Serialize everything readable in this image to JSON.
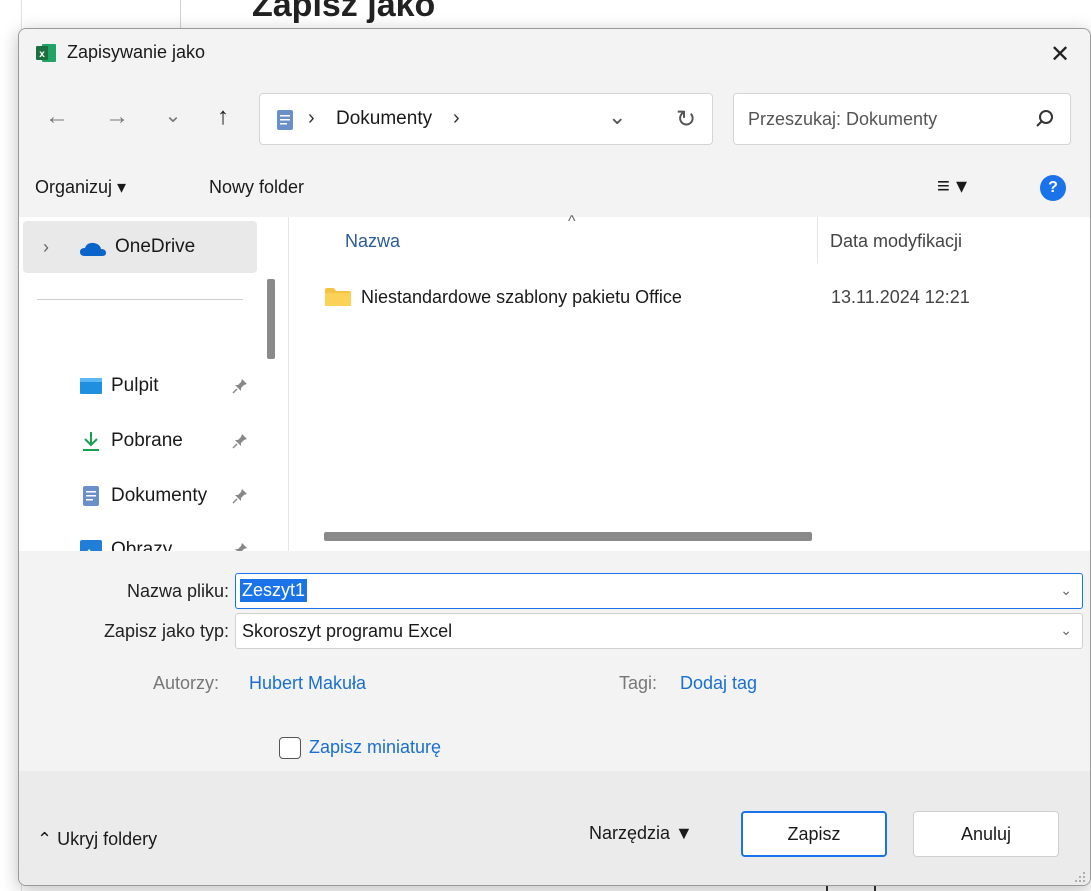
{
  "background": {
    "title": "Zapisz jako"
  },
  "dialog": {
    "title": "Zapisywanie jako",
    "close_glyph": "✕",
    "app_icon_letter": "x"
  },
  "nav": {
    "back_glyph": "←",
    "forward_glyph": "→",
    "recent_glyph": "⌄",
    "up_glyph": "↑"
  },
  "address": {
    "path_separator": "›",
    "location": "Dokumenty",
    "dropdown_glyph": "⌄",
    "refresh_glyph": "↻"
  },
  "search": {
    "placeholder": "Przeszukaj: Dokumenty"
  },
  "toolbar": {
    "organize": "Organizuj ▾",
    "new_folder": "Nowy folder",
    "view_glyph": "≡ ▾",
    "help_glyph": "?"
  },
  "sidebar": {
    "chevron": "›",
    "onedrive": "OneDrive",
    "items": [
      {
        "label": "Pulpit",
        "icon": "desktop-icon"
      },
      {
        "label": "Pobrane",
        "icon": "download-icon"
      },
      {
        "label": "Dokumenty",
        "icon": "document-icon"
      },
      {
        "label": "Obrazy",
        "icon": "pictures-icon"
      }
    ]
  },
  "file_list": {
    "sort_glyph": "^",
    "columns": [
      "Nazwa",
      "Data modyfikacji"
    ],
    "rows": [
      {
        "name": "Niestandardowe szablony pakietu Office",
        "modified": "13.11.2024 12:21",
        "icon": "folder-icon"
      }
    ]
  },
  "form": {
    "filename_label": "Nazwa pliku:",
    "filename_value": "Zeszyt1",
    "type_label": "Zapisz jako typ:",
    "type_value": "Skoroszyt programu Excel",
    "dropdown_glyph": "⌄",
    "authors_label": "Autorzy:",
    "authors_value": "Hubert Makuła",
    "tags_label": "Tagi:",
    "tags_value": "Dodaj tag",
    "thumbnail_label": "Zapisz miniaturę",
    "thumbnail_checked": false
  },
  "footer": {
    "hide_folders": "⌃ Ukryj foldery",
    "tools": "Narzędzia  ▼",
    "save": "Zapisz",
    "cancel": "Anuluj"
  },
  "colors": {
    "accent": "#1a73e8",
    "link": "#1a6fd1",
    "excel_green": "#1d6f42",
    "folder_yellow": "#f4c542"
  }
}
